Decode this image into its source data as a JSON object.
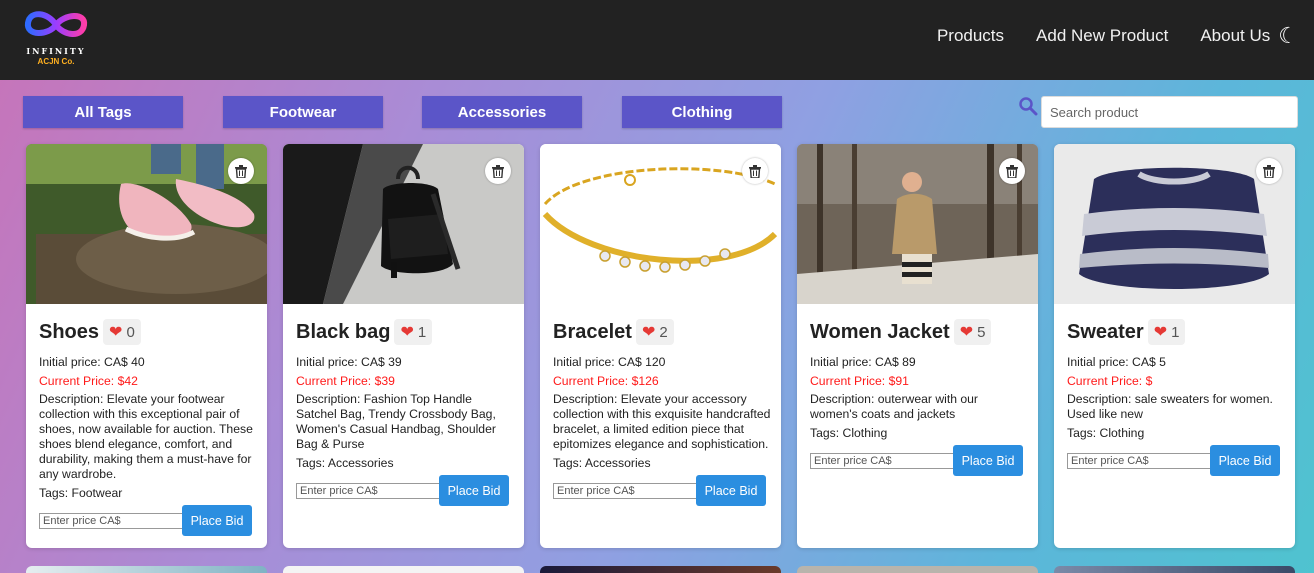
{
  "brand": {
    "name": "INFINITY",
    "sub": "ACJN Co."
  },
  "nav": {
    "items": [
      "Products",
      "Add New Product",
      "About Us"
    ],
    "theme_icon": "moon-icon"
  },
  "filters": {
    "tags": [
      "All Tags",
      "Footwear",
      "Accessories",
      "Clothing"
    ]
  },
  "search": {
    "placeholder": "Search product",
    "icon": "search-icon"
  },
  "bid": {
    "placeholder": "Enter price CA$",
    "button": "Place Bid"
  },
  "products": [
    {
      "title": "Shoes",
      "likes": "0",
      "initial": "Initial price: CA$ 40",
      "current": "Current Price: $42",
      "description": "Description: Elevate your footwear collection with this exceptional pair of shoes, now available for auction. These shoes blend elegance, comfort, and durability, making them a must-have for any wardrobe.",
      "tags": "Tags: Footwear"
    },
    {
      "title": "Black bag",
      "likes": "1",
      "initial": "Initial price: CA$ 39",
      "current": "Current Price: $39",
      "description": "Description: Fashion Top Handle Satchel Bag, Trendy Crossbody Bag, Women's Casual Handbag, Shoulder Bag & Purse",
      "tags": "Tags: Accessories"
    },
    {
      "title": "Bracelet",
      "likes": "2",
      "initial": "Initial price: CA$ 120",
      "current": "Current Price: $126",
      "description": "Description: Elevate your accessory collection with this exquisite handcrafted bracelet, a limited edition piece that epitomizes elegance and sophistication.",
      "tags": "Tags: Accessories"
    },
    {
      "title": "Women Jacket",
      "likes": "5",
      "initial": "Initial price: CA$ 89",
      "current": "Current Price: $91",
      "description": "Description: outerwear with our women's coats and jackets",
      "tags": "Tags: Clothing"
    },
    {
      "title": "Sweater",
      "likes": "1",
      "initial": "Initial price: CA$ 5",
      "current": "Current Price: $",
      "description": "Description: sale sweaters for women. Used like new",
      "tags": "Tags: Clothing"
    }
  ],
  "colors": {
    "topbar": "#222222",
    "tag_button": "#5b55c8",
    "bid_button": "#2b8ee0",
    "current_price": "#ff1a1a",
    "heart": "#e53935"
  }
}
